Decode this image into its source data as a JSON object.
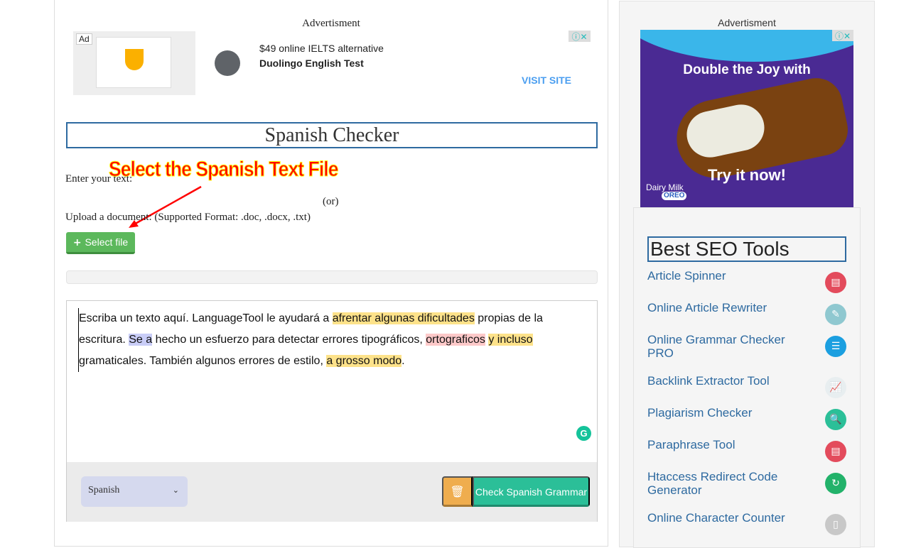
{
  "ad_top": {
    "label": "Advertisment",
    "badge": "Ad",
    "headline": "$49 online IELTS alternative",
    "advertiser": "Duolingo English Test",
    "cta": "VISIT SITE"
  },
  "page": {
    "title": "Spanish Checker",
    "enter_label": "Enter your text:",
    "or_label": "(or)",
    "upload_label": "Upload a document: (Supported Format: .doc, .docx, .txt)",
    "select_file": "Select file"
  },
  "annotation": {
    "callout": "Select the Spanish Text File",
    "color": "#ff0000"
  },
  "editor": {
    "segments": [
      {
        "t": "Escriba un texto aquí. LanguageTool le ayudará a ",
        "h": ""
      },
      {
        "t": "afrentar algunas dificultades",
        "h": "y"
      },
      {
        "t": " propias de la escritura. ",
        "h": ""
      },
      {
        "t": "Se a",
        "h": "b"
      },
      {
        "t": " hecho un esfuerzo para detectar errores tipográficos, ",
        "h": ""
      },
      {
        "t": "ortograficos",
        "h": "r"
      },
      {
        "t": " ",
        "h": ""
      },
      {
        "t": "y incluso",
        "h": "y"
      },
      {
        "t": " gramaticales. También algunos errores de estilo, ",
        "h": ""
      },
      {
        "t": "a grosso modo",
        "h": "y"
      },
      {
        "t": ".",
        "h": ""
      }
    ],
    "language": "Spanish",
    "check_button": "Check Spanish Grammar",
    "grammarly_glyph": "G"
  },
  "ad_side": {
    "label": "Advertisment",
    "headline": "Double the Joy with",
    "cta": "Try it now!",
    "brand": "Dairy Milk",
    "sub_brand": "OREO"
  },
  "seo": {
    "title": "Best SEO Tools",
    "items": [
      {
        "label": "Article Spinner",
        "icon": "document-icon",
        "color": "#e34b5c"
      },
      {
        "label": "Online Article Rewriter",
        "icon": "pencil-doc-icon",
        "color": "#8fc8d0"
      },
      {
        "label": "Online Grammar Checker PRO",
        "icon": "checklist-icon",
        "color": "#1b9fe0"
      },
      {
        "label": "Backlink Extractor Tool",
        "icon": "chart-icon",
        "color": "#e8eef0"
      },
      {
        "label": "Plagiarism Checker",
        "icon": "magnifier-icon",
        "color": "#2bbf98"
      },
      {
        "label": "Paraphrase Tool",
        "icon": "document-icon",
        "color": "#e34b5c"
      },
      {
        "label": "Htaccess Redirect Code Generator",
        "icon": "redirect-icon",
        "color": "#22b26a"
      },
      {
        "label": "Online Character Counter",
        "icon": "page-icon",
        "color": "#c8c8c8"
      }
    ]
  }
}
